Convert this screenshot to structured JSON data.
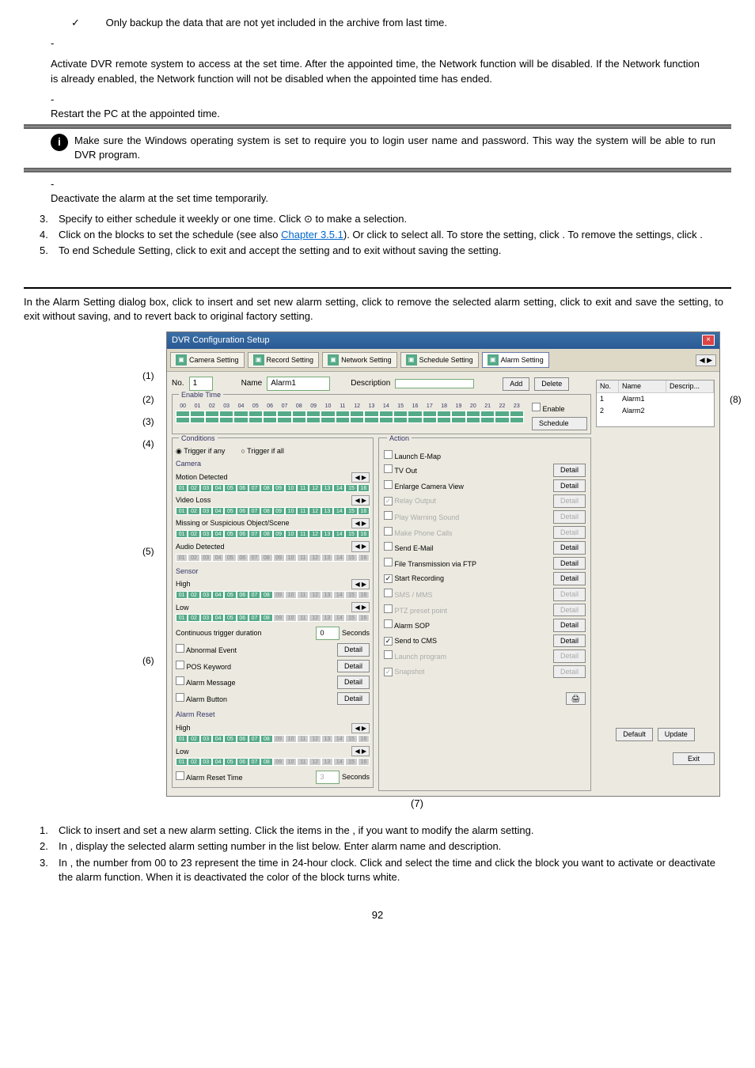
{
  "top": {
    "check": "✓",
    "backup_text": "Only backup the data that are not yet included in the archive from last time."
  },
  "paras": {
    "p1_dash": "-",
    "p1": "Activate DVR remote system to access at the set time. After the appointed time, the Network function will be disabled. If the Network function is already enabled, the Network function will not be disabled when the appointed time has ended.",
    "p2_dash": "-",
    "p2": "Restart the PC at the appointed time.",
    "note": "Make sure the Windows operating system is set        to require you to login user name and password. This way the system will be able to run DVR program.",
    "p3_dash": "-",
    "p3": "Deactivate the alarm at the set time temporarily."
  },
  "steps_a": [
    {
      "n": "3.",
      "t": "Specify to either schedule it weekly or one time. Click ⊙ to make a selection."
    },
    {
      "n": "4.",
      "t_pre": "Click on the blocks to set the schedule (see also ",
      "link": "Chapter 3.5.1",
      "t_post": "). Or click       to select all. To store the setting, click        . To remove the settings, click        ."
    },
    {
      "n": "5.",
      "t": "To end Schedule Setting, click          to exit and accept the setting and        to exit without saving the setting."
    }
  ],
  "section_text": "In the Alarm Setting dialog box, click         to insert and set new alarm setting, click         to remove the selected alarm setting, click        to exit and save the setting,          to exit without saving, and          to revert back to original factory setting.",
  "dialog": {
    "title": "DVR Configuration Setup",
    "tabs": [
      "Camera Setting",
      "Record Setting",
      "Network Setting",
      "Schedule Setting",
      "Alarm Setting"
    ],
    "no_label": "No.",
    "no_val": "1",
    "name_label": "Name",
    "name_val": "Alarm1",
    "desc_label": "Description",
    "add": "Add",
    "delete": "Delete",
    "enable_time": "Enable Time",
    "hours": [
      "00",
      "01",
      "02",
      "03",
      "04",
      "05",
      "06",
      "07",
      "08",
      "09",
      "10",
      "11",
      "12",
      "13",
      "14",
      "15",
      "16",
      "17",
      "18",
      "19",
      "20",
      "21",
      "22",
      "23"
    ],
    "enable_chk": "Enable",
    "schedule_btn": "Schedule",
    "conditions": "Conditions",
    "trigger_any": "Trigger if any",
    "trigger_all": "Trigger if all",
    "camera": "Camera",
    "motion": "Motion Detected",
    "video_loss": "Video Loss",
    "missing": "Missing or Suspicious Object/Scene",
    "audio": "Audio Detected",
    "cams": [
      "01",
      "02",
      "03",
      "04",
      "05",
      "06",
      "07",
      "08",
      "09",
      "10",
      "11",
      "12",
      "13",
      "14",
      "15",
      "16"
    ],
    "sensor": "Sensor",
    "high": "High",
    "low": "Low",
    "cont_trigger": "Continuous trigger duration",
    "cont_val": "0",
    "seconds": "Seconds",
    "abnormal": "Abnormal Event",
    "pos_kw": "POS Keyword",
    "alarm_msg": "Alarm Message",
    "alarm_btn": "Alarm Button",
    "alarm_reset": "Alarm Reset",
    "reset_time": "Alarm Reset Time",
    "reset_val": "3",
    "action": "Action",
    "actions": [
      {
        "label": "Launch E-Map",
        "chk": false,
        "dim": false,
        "detail": false
      },
      {
        "label": "TV Out",
        "chk": false,
        "dim": false,
        "detail": true
      },
      {
        "label": "Enlarge Camera View",
        "chk": false,
        "dim": false,
        "detail": true
      },
      {
        "label": "Relay Output",
        "chk": true,
        "dim": true,
        "detail": true
      },
      {
        "label": "Play Warning Sound",
        "chk": false,
        "dim": true,
        "detail": true
      },
      {
        "label": "Make Phone Calls",
        "chk": false,
        "dim": true,
        "detail": true
      },
      {
        "label": "Send E-Mail",
        "chk": false,
        "dim": false,
        "detail": true
      },
      {
        "label": "File Transmission via FTP",
        "chk": false,
        "dim": false,
        "detail": true
      },
      {
        "label": "Start Recording",
        "chk": true,
        "dim": false,
        "detail": true
      },
      {
        "label": "SMS / MMS",
        "chk": false,
        "dim": true,
        "detail": true
      },
      {
        "label": "PTZ preset point",
        "chk": false,
        "dim": true,
        "detail": true
      },
      {
        "label": "Alarm SOP",
        "chk": false,
        "dim": false,
        "detail": true
      },
      {
        "label": "Send to CMS",
        "chk": true,
        "dim": false,
        "detail": true
      },
      {
        "label": "Launch program",
        "chk": false,
        "dim": true,
        "detail": true
      },
      {
        "label": "Snapshot",
        "chk": true,
        "dim": true,
        "detail": true
      }
    ],
    "detail": "Detail",
    "alarm_list_h": [
      "No.",
      "Name",
      "Descrip..."
    ],
    "alarm_rows": [
      {
        "no": "1",
        "name": "Alarm1"
      },
      {
        "no": "2",
        "name": "Alarm2"
      }
    ],
    "default": "Default",
    "update": "Update",
    "exit": "Exit"
  },
  "callouts": {
    "c1": "(1)",
    "c2": "(2)",
    "c3": "(3)",
    "c4": "(4)",
    "c5": "(5)",
    "c6": "(6)",
    "c7": "(7)",
    "c8": "(8)"
  },
  "steps_b": [
    {
      "n": "1.",
      "t": "Click        to insert and set a new alarm setting. Click the items in the                              , if you want to modify the alarm setting."
    },
    {
      "n": "2.",
      "t": "In                                                              , display the selected alarm setting number in the list below. Enter alarm name and description."
    },
    {
      "n": "3.",
      "t": "In                        , the number from 00 to 23 represent the time in 24-hour clock. Click             and select the time and click the block you want to activate or deactivate the alarm function. When it is deactivated the color of the block turns white."
    }
  ],
  "page": "92"
}
